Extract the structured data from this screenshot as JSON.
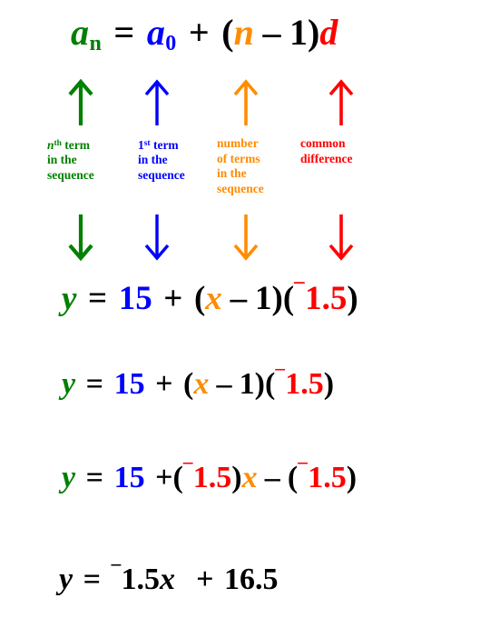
{
  "page": {
    "title": "Arithmetic sequence formula to linear equation",
    "background": "#ffffff"
  },
  "colors": {
    "green": "#008000",
    "blue": "#0000ff",
    "orange": "#ff8c00",
    "red": "#ff0000",
    "black": "#000000"
  },
  "formula": {
    "plain": "a_n = a_0 + (n - 1)d",
    "a_green": "a",
    "a_green_sub": "n",
    "equals": "=",
    "a_blue": "a",
    "a_blue_sub": "0",
    "plus": "+",
    "paren_open": "(",
    "n_orange": "n",
    "minus": "–",
    "one": "1",
    "paren_close": ")",
    "d_red": "d"
  },
  "annotations": [
    {
      "color": "#008000",
      "arrow_up": "up-arrow",
      "arrow_down": "down-arrow",
      "lines": [
        "n^th term",
        "in the",
        "sequence"
      ],
      "line1_base": "n",
      "line1_sup": "th",
      "line1_rest": " term",
      "line2": "in the",
      "line3": "sequence",
      "line4": ""
    },
    {
      "color": "#0000ff",
      "arrow_up": "up-arrow",
      "arrow_down": "down-arrow",
      "lines": [
        "1^st term",
        "in the",
        "sequence"
      ],
      "line1_base": "1",
      "line1_sup": "st",
      "line1_rest": " term",
      "line2": "in the",
      "line3": "sequence",
      "line4": ""
    },
    {
      "color": "#ff8c00",
      "arrow_up": "up-arrow",
      "arrow_down": "down-arrow",
      "lines": [
        "number",
        "of terms",
        "in the",
        "sequence"
      ],
      "line1_base": "number",
      "line1_sup": "",
      "line1_rest": "",
      "line2": "of terms",
      "line3": "in the",
      "line4": "sequence"
    },
    {
      "color": "#ff0000",
      "arrow_up": "up-arrow",
      "arrow_down": "down-arrow",
      "lines": [
        "common",
        "difference"
      ],
      "line1_base": "common",
      "line1_sup": "",
      "line1_rest": "",
      "line2": "difference",
      "line3": "",
      "line4": ""
    }
  ],
  "equations": [
    {
      "id": "eq-1",
      "plain": "y = 15 + (x - 1)(-1.5)",
      "y": "y",
      "equals": "=",
      "fifteen": "15",
      "plus": "+",
      "paren_open_1": "(",
      "x": "x",
      "minus": "–",
      "one": "1",
      "paren_close_1": ")",
      "paren_open_2": "(",
      "neg": "¯",
      "value": "1.5",
      "paren_close_2": ")"
    },
    {
      "id": "eq-2",
      "plain": "y = 15 + (x - 1)(-1.5)",
      "y": "y",
      "equals": "=",
      "fifteen": "15",
      "plus": "+",
      "paren_open_1": "(",
      "x": "x",
      "minus": "–",
      "one": "1",
      "paren_close_1": ")",
      "paren_open_2": "(",
      "neg": "¯",
      "value": "1.5",
      "paren_close_2": ")"
    },
    {
      "id": "eq-3",
      "plain": "y = 15 + (-1.5)x - (-1.5)",
      "y": "y",
      "equals": "=",
      "fifteen": "15",
      "plus": "+",
      "paren_open_1": "(",
      "neg_1": "¯",
      "value_1": "1.5",
      "paren_close_1": ")",
      "x": "x",
      "minus": "–",
      "paren_open_2": "(",
      "neg_2": "¯",
      "value_2": "1.5",
      "paren_close_2": ")"
    },
    {
      "id": "eq-4",
      "plain": "y = -1.5x + 16.5",
      "y": "y",
      "equals": "=",
      "neg": "¯",
      "slope": "1.5",
      "x": "x",
      "plus": "+",
      "intercept": "16.5"
    }
  ]
}
